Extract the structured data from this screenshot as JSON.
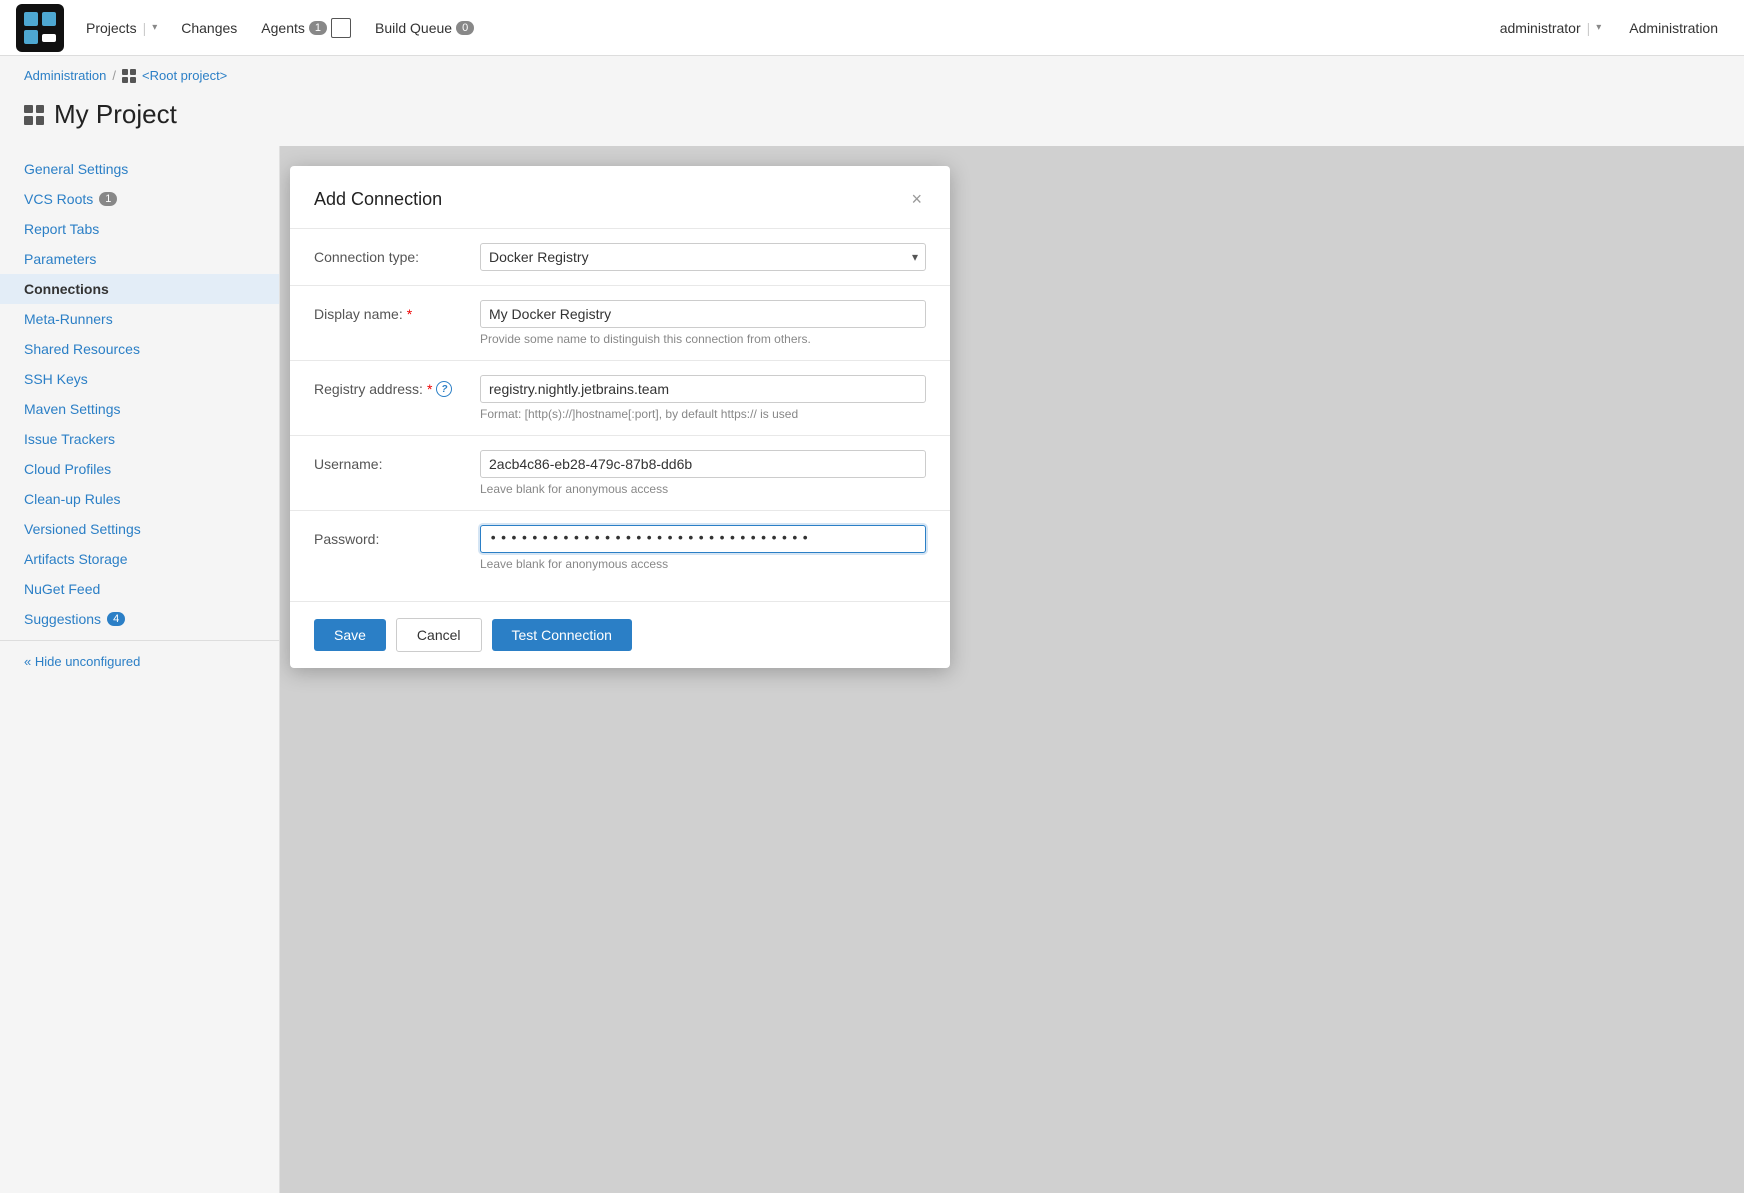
{
  "nav": {
    "projects_label": "Projects",
    "changes_label": "Changes",
    "agents_label": "Agents",
    "agents_badge": "1",
    "build_queue_label": "Build Queue",
    "build_queue_badge": "0",
    "admin_user": "administrator",
    "administration": "Administration"
  },
  "breadcrumb": {
    "administration": "Administration",
    "separator": "/",
    "root_project": "<Root project>"
  },
  "page": {
    "title": "My Project"
  },
  "sidebar": {
    "items": [
      {
        "label": "General Settings",
        "active": false,
        "badge": null
      },
      {
        "label": "VCS Roots",
        "active": false,
        "badge": "1"
      },
      {
        "label": "Report Tabs",
        "active": false,
        "badge": null
      },
      {
        "label": "Parameters",
        "active": false,
        "badge": null
      },
      {
        "label": "Connections",
        "active": true,
        "badge": null
      },
      {
        "label": "Meta-Runners",
        "active": false,
        "badge": null
      },
      {
        "label": "Shared Resources",
        "active": false,
        "badge": null
      },
      {
        "label": "SSH Keys",
        "active": false,
        "badge": null
      },
      {
        "label": "Maven Settings",
        "active": false,
        "badge": null
      },
      {
        "label": "Issue Trackers",
        "active": false,
        "badge": null
      },
      {
        "label": "Cloud Profiles",
        "active": false,
        "badge": null
      },
      {
        "label": "Clean-up Rules",
        "active": false,
        "badge": null
      },
      {
        "label": "Versioned Settings",
        "active": false,
        "badge": null
      },
      {
        "label": "Artifacts Storage",
        "active": false,
        "badge": null
      },
      {
        "label": "NuGet Feed",
        "active": false,
        "badge": null
      },
      {
        "label": "Suggestions",
        "active": false,
        "badge": "4"
      }
    ],
    "hide_label": "« Hide unconfigured"
  },
  "modal": {
    "title": "Add Connection",
    "close_label": "×",
    "connection_type_label": "Connection type:",
    "connection_type_value": "Docker Registry",
    "display_name_label": "Display name:",
    "display_name_value": "My Docker Registry",
    "display_name_hint": "Provide some name to distinguish this connection from others.",
    "registry_address_label": "Registry address:",
    "registry_address_value": "registry.nightly.jetbrains.team",
    "registry_address_hint": "Format: [http(s)://]hostname[:port], by default https:// is used",
    "username_label": "Username:",
    "username_value": "2acb4c86-eb28-479c-87b8-dd6b",
    "username_hint": "Leave blank for anonymous access",
    "password_label": "Password:",
    "password_value": "••••••••••••••••••••••••••••••••",
    "password_hint": "Leave blank for anonymous access",
    "save_label": "Save",
    "cancel_label": "Cancel",
    "test_connection_label": "Test Connection"
  }
}
